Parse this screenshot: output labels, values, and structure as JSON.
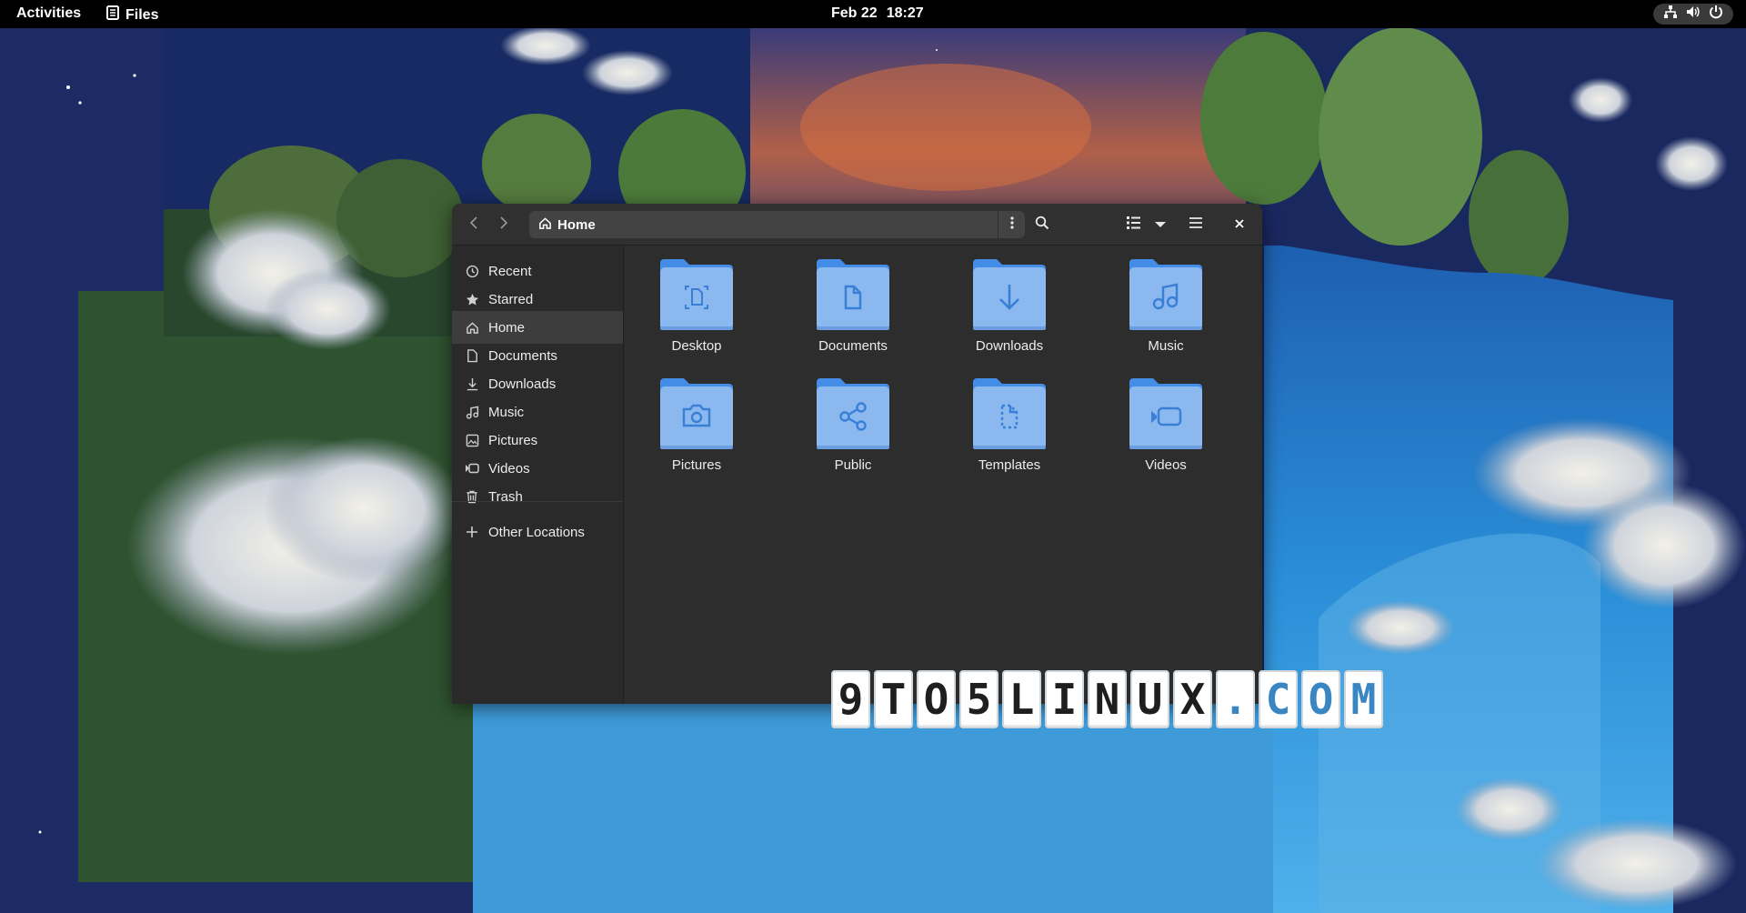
{
  "topbar": {
    "activities": "Activities",
    "app_name": "Files",
    "app_icon": "files-app-icon",
    "date": "Feb 22",
    "time": "18:27",
    "tray_icons": [
      "network-icon",
      "volume-icon",
      "power-icon"
    ]
  },
  "window": {
    "path_label": "Home",
    "path_icon": "home-icon",
    "toolbar_icons": [
      "back-icon",
      "forward-icon",
      "path-menu-icon",
      "search-icon",
      "list-view-icon",
      "view-dropdown-icon",
      "main-menu-icon",
      "close-icon"
    ],
    "sidebar": {
      "items": [
        {
          "label": "Recent",
          "icon": "recent-icon"
        },
        {
          "label": "Starred",
          "icon": "star-icon"
        },
        {
          "label": "Home",
          "icon": "home-icon",
          "selected": true
        },
        {
          "label": "Documents",
          "icon": "document-icon"
        },
        {
          "label": "Downloads",
          "icon": "download-icon"
        },
        {
          "label": "Music",
          "icon": "music-icon"
        },
        {
          "label": "Pictures",
          "icon": "picture-icon"
        },
        {
          "label": "Videos",
          "icon": "video-icon"
        },
        {
          "label": "Trash",
          "icon": "trash-icon"
        }
      ],
      "other_locations": {
        "label": "Other Locations",
        "icon": "plus-icon"
      }
    },
    "folders": [
      {
        "label": "Desktop",
        "icon": "desktop-folder-icon"
      },
      {
        "label": "Documents",
        "icon": "documents-folder-icon"
      },
      {
        "label": "Downloads",
        "icon": "downloads-folder-icon"
      },
      {
        "label": "Music",
        "icon": "music-folder-icon"
      },
      {
        "label": "Pictures",
        "icon": "pictures-folder-icon"
      },
      {
        "label": "Public",
        "icon": "public-folder-icon"
      },
      {
        "label": "Templates",
        "icon": "templates-folder-icon"
      },
      {
        "label": "Videos",
        "icon": "videos-folder-icon"
      }
    ]
  },
  "watermark": {
    "chars": [
      "9",
      "T",
      "O",
      "5",
      "L",
      "I",
      "N",
      "U",
      "X",
      ".",
      "C",
      "O",
      "M"
    ],
    "dark_color": "#1e1e1e",
    "blue_color": "#3a86c3"
  },
  "colors": {
    "topbar": "#000000",
    "window_bg": "#2d2d2d",
    "sidebar_bg": "#2a2a2a",
    "selected_row": "#3d3d3d",
    "folder_blue": "#8ab8ef",
    "folder_tab": "#438de6",
    "folder_glyph": "#3a7fd6"
  }
}
